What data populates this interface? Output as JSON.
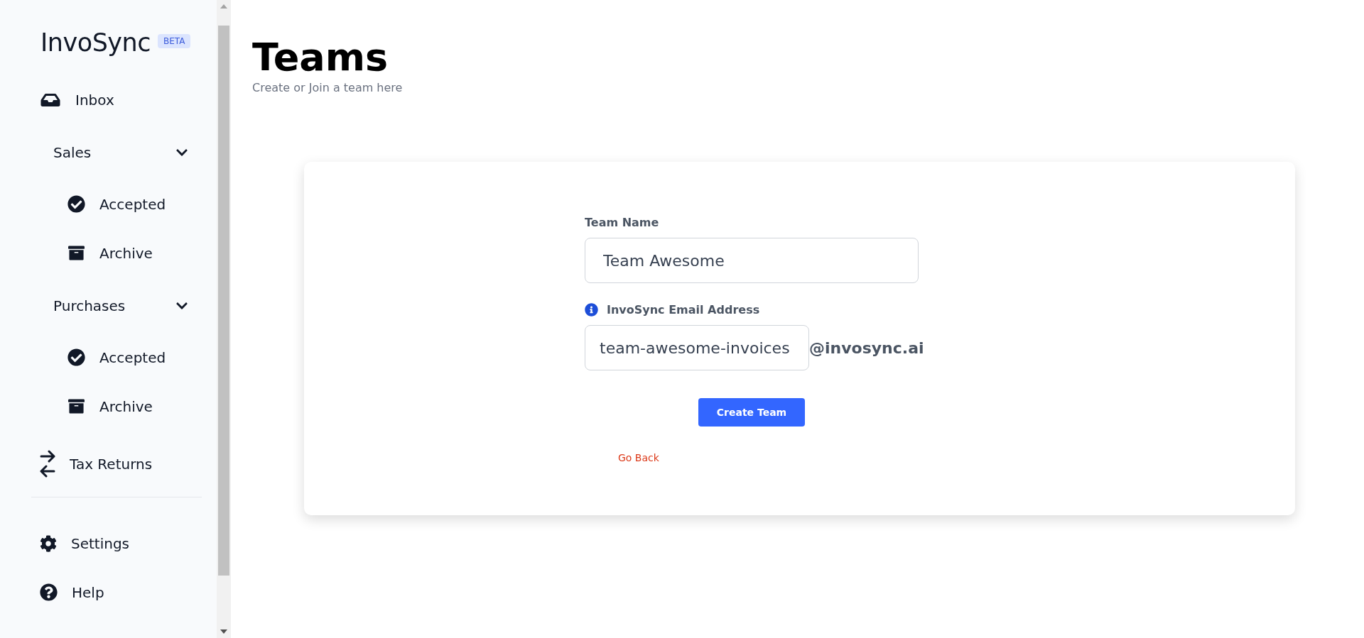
{
  "sidebar": {
    "logo": "InvoSync",
    "badge": "BETA",
    "items": [
      {
        "kind": "link",
        "label": "Inbox"
      },
      {
        "kind": "group",
        "label": "Sales",
        "expanded": true,
        "children": [
          {
            "label": "Accepted"
          },
          {
            "label": "Archive"
          }
        ]
      },
      {
        "kind": "group",
        "label": "Purchases",
        "expanded": true,
        "children": [
          {
            "label": "Accepted"
          },
          {
            "label": "Archive"
          }
        ]
      },
      {
        "kind": "link",
        "label": "Tax Returns"
      }
    ],
    "footer_items": [
      {
        "label": "Settings"
      },
      {
        "label": "Help"
      }
    ]
  },
  "page": {
    "title": "Teams",
    "subtitle": "Create or Join a team here"
  },
  "form": {
    "team_name": {
      "label": "Team Name",
      "value": "Team Awesome"
    },
    "email": {
      "label": "InvoSync Email Address",
      "value": "team-awesome-invoices",
      "suffix": "@invosync.ai"
    },
    "submit": "Create Team",
    "back": "Go Back"
  }
}
